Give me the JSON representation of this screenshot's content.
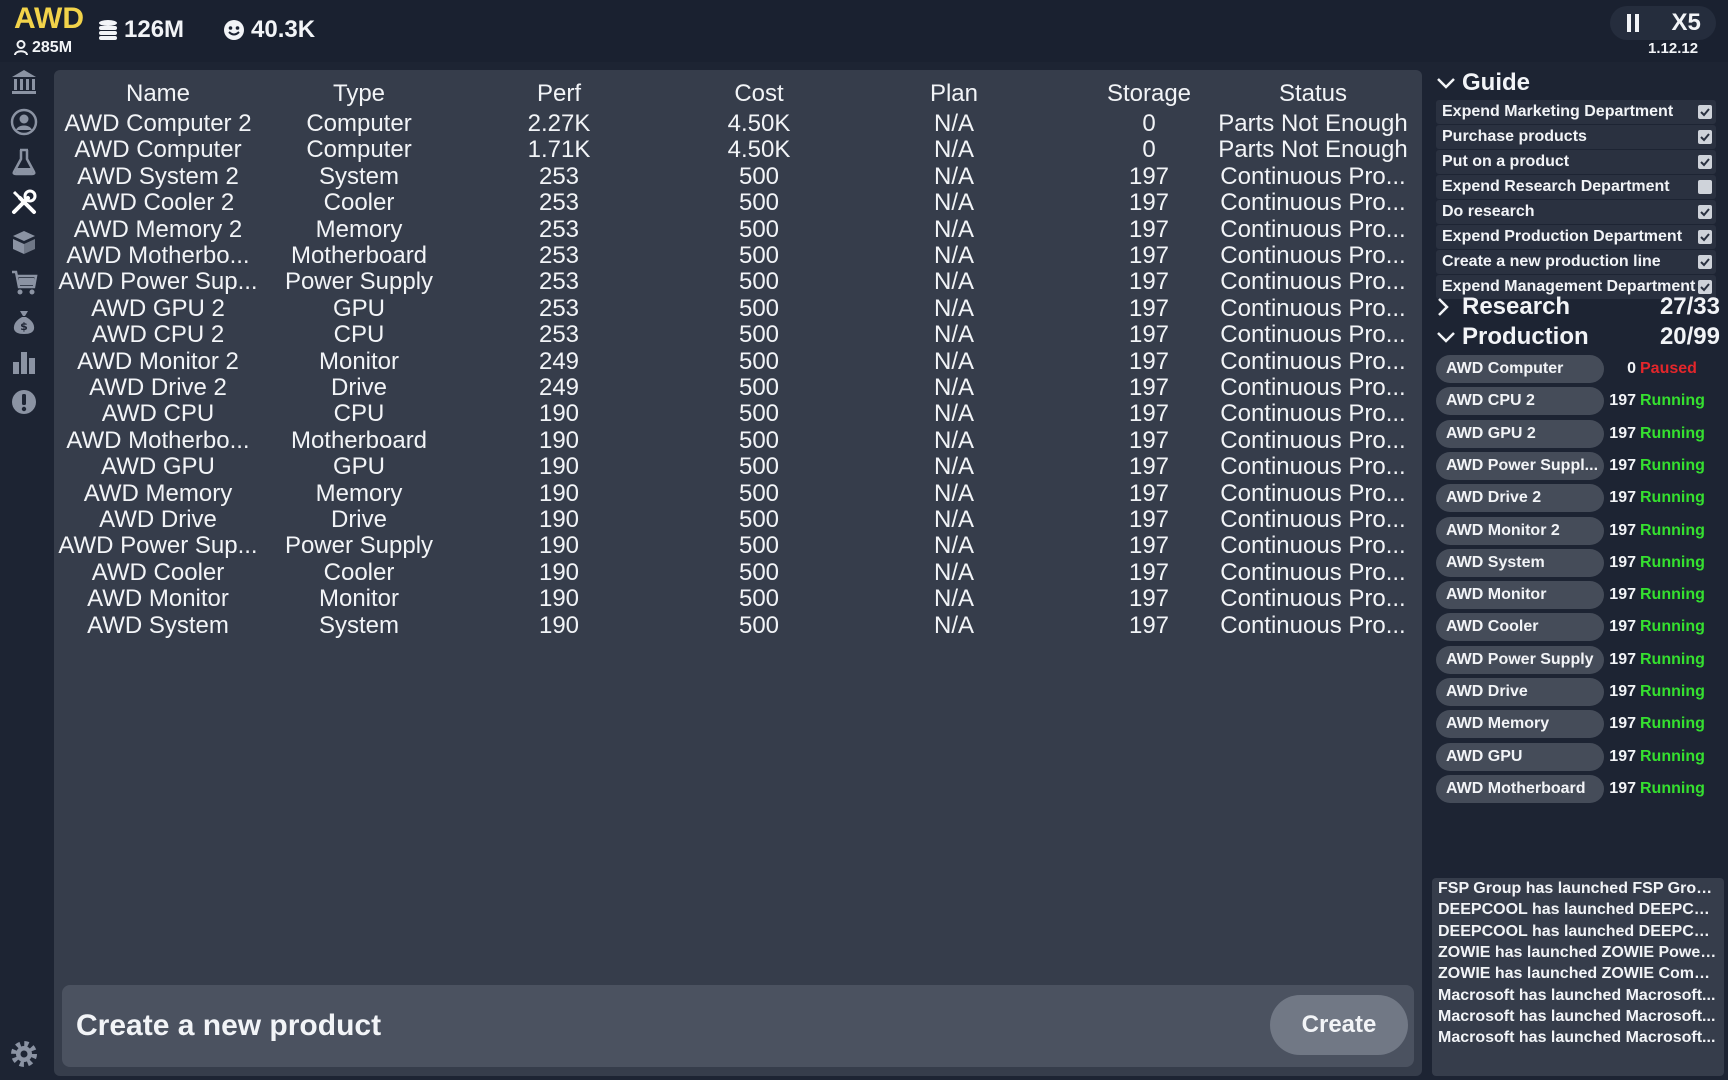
{
  "topbar": {
    "company": "AWD",
    "worth": "285M",
    "money": "126M",
    "fans": "40.3K",
    "speed": "X5",
    "version": "1.12.12"
  },
  "table": {
    "headers": [
      "Name",
      "Type",
      "Perf",
      "Cost",
      "Plan",
      "Storage",
      "Status"
    ],
    "rows": [
      [
        "AWD Computer 2",
        "Computer",
        "2.27K",
        "4.50K",
        "N/A",
        "0",
        "Parts Not Enough"
      ],
      [
        "AWD Computer",
        "Computer",
        "1.71K",
        "4.50K",
        "N/A",
        "0",
        "Parts Not Enough"
      ],
      [
        "AWD System 2",
        "System",
        "253",
        "500",
        "N/A",
        "197",
        "Continuous Pro..."
      ],
      [
        "AWD Cooler 2",
        "Cooler",
        "253",
        "500",
        "N/A",
        "197",
        "Continuous Pro..."
      ],
      [
        "AWD Memory 2",
        "Memory",
        "253",
        "500",
        "N/A",
        "197",
        "Continuous Pro..."
      ],
      [
        "AWD Motherbo...",
        "Motherboard",
        "253",
        "500",
        "N/A",
        "197",
        "Continuous Pro..."
      ],
      [
        "AWD Power Sup...",
        "Power Supply",
        "253",
        "500",
        "N/A",
        "197",
        "Continuous Pro..."
      ],
      [
        "AWD GPU 2",
        "GPU",
        "253",
        "500",
        "N/A",
        "197",
        "Continuous Pro..."
      ],
      [
        "AWD CPU 2",
        "CPU",
        "253",
        "500",
        "N/A",
        "197",
        "Continuous Pro..."
      ],
      [
        "AWD Monitor 2",
        "Monitor",
        "249",
        "500",
        "N/A",
        "197",
        "Continuous Pro..."
      ],
      [
        "AWD Drive 2",
        "Drive",
        "249",
        "500",
        "N/A",
        "197",
        "Continuous Pro..."
      ],
      [
        "AWD CPU",
        "CPU",
        "190",
        "500",
        "N/A",
        "197",
        "Continuous Pro..."
      ],
      [
        "AWD Motherbo...",
        "Motherboard",
        "190",
        "500",
        "N/A",
        "197",
        "Continuous Pro..."
      ],
      [
        "AWD GPU",
        "GPU",
        "190",
        "500",
        "N/A",
        "197",
        "Continuous Pro..."
      ],
      [
        "AWD Memory",
        "Memory",
        "190",
        "500",
        "N/A",
        "197",
        "Continuous Pro..."
      ],
      [
        "AWD Drive",
        "Drive",
        "190",
        "500",
        "N/A",
        "197",
        "Continuous Pro..."
      ],
      [
        "AWD Power Sup...",
        "Power Supply",
        "190",
        "500",
        "N/A",
        "197",
        "Continuous Pro..."
      ],
      [
        "AWD Cooler",
        "Cooler",
        "190",
        "500",
        "N/A",
        "197",
        "Continuous Pro..."
      ],
      [
        "AWD Monitor",
        "Monitor",
        "190",
        "500",
        "N/A",
        "197",
        "Continuous Pro..."
      ],
      [
        "AWD System",
        "System",
        "190",
        "500",
        "N/A",
        "197",
        "Continuous Pro..."
      ]
    ]
  },
  "create": {
    "title": "Create a new product",
    "button": "Create"
  },
  "guide": {
    "title": "Guide",
    "items": [
      "Expend Marketing Department",
      "Purchase products",
      "Put on a product",
      "Expend Research Department",
      "Do research",
      "Expend Production Department",
      "Create a new production line",
      "Expend Management Department"
    ]
  },
  "research": {
    "title": "Research",
    "count": "27/33"
  },
  "production": {
    "title": "Production",
    "count": "20/99",
    "items": [
      {
        "name": "AWD Computer",
        "count": "0",
        "status": "Paused"
      },
      {
        "name": "AWD CPU 2",
        "count": "197",
        "status": "Running"
      },
      {
        "name": "AWD GPU 2",
        "count": "197",
        "status": "Running"
      },
      {
        "name": "AWD Power Suppl...",
        "count": "197",
        "status": "Running"
      },
      {
        "name": "AWD Drive 2",
        "count": "197",
        "status": "Running"
      },
      {
        "name": "AWD Monitor 2",
        "count": "197",
        "status": "Running"
      },
      {
        "name": "AWD System",
        "count": "197",
        "status": "Running"
      },
      {
        "name": "AWD Monitor",
        "count": "197",
        "status": "Running"
      },
      {
        "name": "AWD Cooler",
        "count": "197",
        "status": "Running"
      },
      {
        "name": "AWD Power Supply",
        "count": "197",
        "status": "Running"
      },
      {
        "name": "AWD Drive",
        "count": "197",
        "status": "Running"
      },
      {
        "name": "AWD Memory",
        "count": "197",
        "status": "Running"
      },
      {
        "name": "AWD GPU",
        "count": "197",
        "status": "Running"
      },
      {
        "name": "AWD Motherboard",
        "count": "197",
        "status": "Running"
      }
    ]
  },
  "news": [
    "FSP Group has launched FSP Group...",
    "DEEPCOOL has launched DEEPCOO...",
    "DEEPCOOL has launched DEEPCOO...",
    "ZOWIE has launched ZOWIE Power...",
    "ZOWIE has launched ZOWIE Compu...",
    "Macrosoft has launched Macrosoft...",
    "Macrosoft has launched Macrosoft...",
    "Macrosoft has launched Macrosoft..."
  ],
  "colors": {
    "accent_gold": "#f2d34a",
    "running": "#35e02f",
    "paused": "#e3262b"
  },
  "nav_icons": [
    "bank-icon",
    "user-icon",
    "flask-icon",
    "tools-icon",
    "boxes-icon",
    "cart-icon",
    "money-bag-icon",
    "chart-icon",
    "alert-icon"
  ]
}
